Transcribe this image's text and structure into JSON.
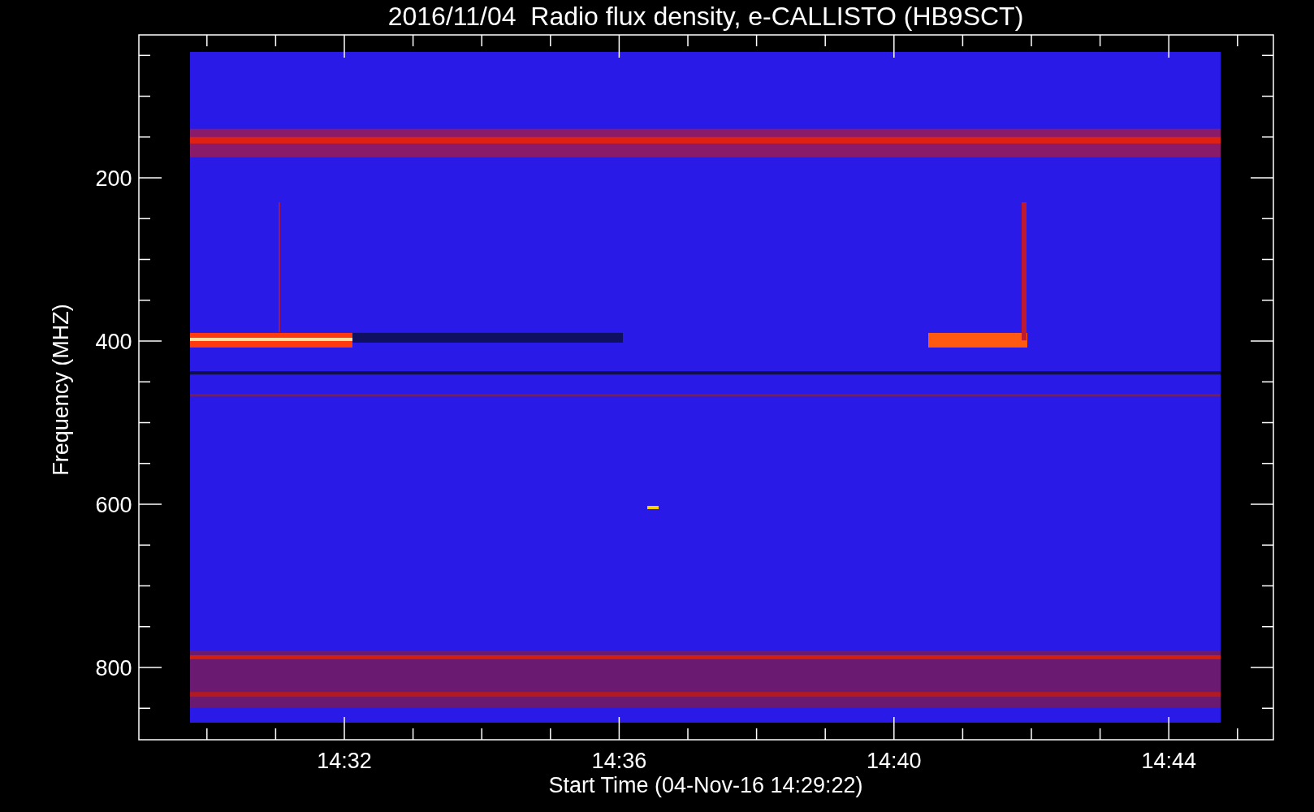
{
  "title": "2016/11/04  Radio flux density, e-CALLISTO (HB9SCT)",
  "y_axis": {
    "label": "Frequency (MHZ)",
    "ticks": [
      "200",
      "400",
      "600",
      "800"
    ]
  },
  "x_axis": {
    "label": "Start Time (04-Nov-16 14:29:22)",
    "ticks": [
      "14:32",
      "14:36",
      "14:40",
      "14:44"
    ]
  }
}
